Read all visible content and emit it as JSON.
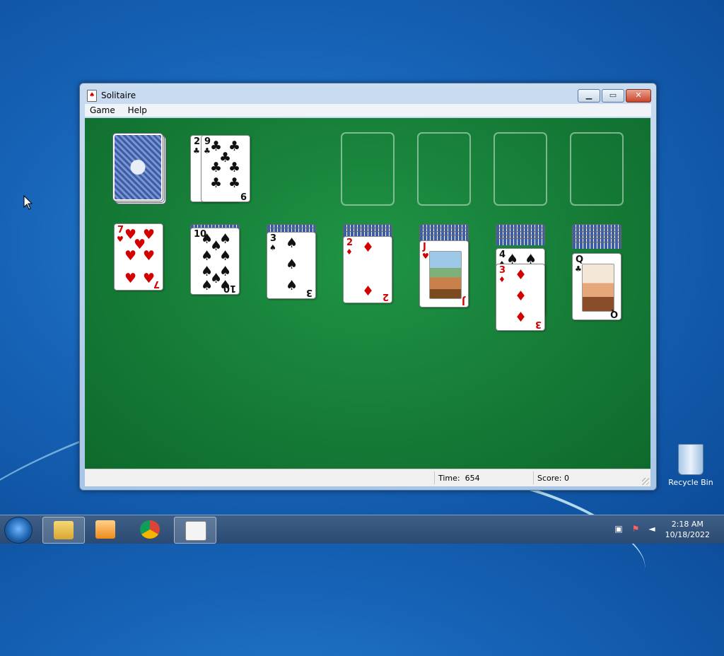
{
  "window": {
    "title": "Solitaire",
    "menu": [
      "Game",
      "Help"
    ],
    "controls": [
      "minimize",
      "maximize",
      "close"
    ]
  },
  "status": {
    "time_label": "Time:",
    "time_value": "654",
    "score_label": "Score:",
    "score_value": "0"
  },
  "stock": {
    "face_down": true
  },
  "waste": [
    {
      "rank": "2",
      "suit": "♣",
      "color": "black"
    },
    {
      "rank": "9",
      "suit": "♣",
      "color": "black"
    }
  ],
  "foundations": [
    {},
    {},
    {},
    {}
  ],
  "tableau": [
    {
      "hidden": 0,
      "top": {
        "rank": "7",
        "suit": "♥",
        "color": "red"
      }
    },
    {
      "hidden": 1,
      "top": {
        "rank": "10",
        "suit": "♠",
        "color": "black"
      }
    },
    {
      "hidden": 2,
      "top": {
        "rank": "3",
        "suit": "♠",
        "color": "black"
      }
    },
    {
      "hidden": 3,
      "top": {
        "rank": "2",
        "suit": "♦",
        "color": "red"
      }
    },
    {
      "hidden": 4,
      "top": {
        "rank": "J",
        "suit": "♥",
        "color": "red"
      }
    },
    {
      "hidden": 5,
      "under": {
        "rank": "4",
        "suit": "♠",
        "color": "black"
      },
      "top": {
        "rank": "3",
        "suit": "♦",
        "color": "red"
      }
    },
    {
      "hidden": 6,
      "top": {
        "rank": "Q",
        "suit": "♣",
        "color": "black"
      }
    }
  ],
  "desktop": {
    "recycle_bin_label": "Recycle Bin"
  },
  "taskbar": {
    "pinned": [
      "windows-explorer",
      "media-player",
      "chrome",
      "solitaire"
    ],
    "clock_time": "2:18 AM",
    "clock_date": "10/18/2022"
  },
  "colors": {
    "felt": "#157a36",
    "red_suit": "#d40000",
    "desktop": "#1764b8"
  }
}
